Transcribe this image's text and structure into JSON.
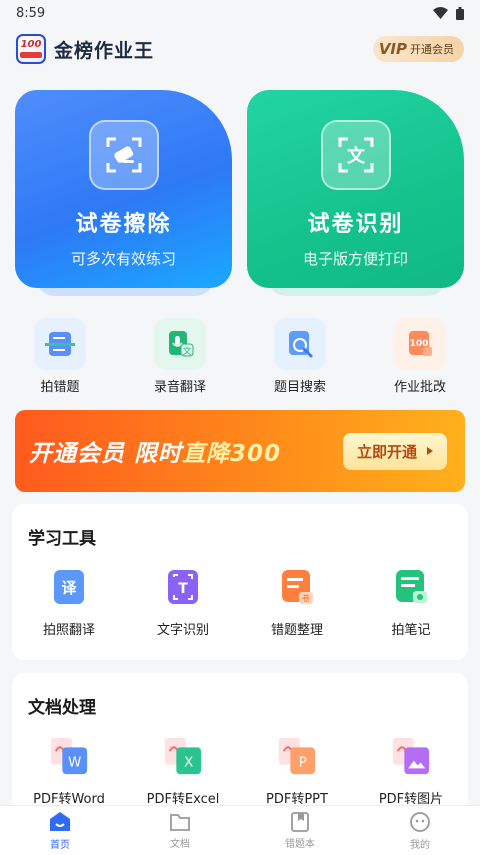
{
  "status": {
    "time": "8:59"
  },
  "header": {
    "app_title": "金榜作业王",
    "logo_text": "100",
    "vip_badge": "VIP",
    "vip_text": "开通会员"
  },
  "hero": [
    {
      "title": "试卷擦除",
      "subtitle": "可多次有效练习",
      "icon": "eraser-icon"
    },
    {
      "title": "试卷识别",
      "subtitle": "电子版方便打印",
      "icon": "scan-text-icon"
    }
  ],
  "quick": [
    {
      "label": "拍错题",
      "icon": "scan-document-icon"
    },
    {
      "label": "录音翻译",
      "icon": "voice-translate-icon"
    },
    {
      "label": "题目搜索",
      "icon": "search-question-icon"
    },
    {
      "label": "作业批改",
      "icon": "grade-homework-icon"
    }
  ],
  "banner": {
    "text_a": "开通会员 限时",
    "text_b": "直降300",
    "button": "立即开通"
  },
  "tools": {
    "title": "学习工具",
    "items": [
      {
        "label": "拍照翻译",
        "icon": "photo-translate-icon"
      },
      {
        "label": "文字识别",
        "icon": "text-recognition-icon"
      },
      {
        "label": "错题整理",
        "icon": "mistake-organize-icon"
      },
      {
        "label": "拍笔记",
        "icon": "photo-notes-icon"
      }
    ]
  },
  "docs": {
    "title": "文档处理",
    "items": [
      {
        "label": "PDF转Word",
        "icon": "pdf-to-word-icon",
        "badge": "W"
      },
      {
        "label": "PDF转Excel",
        "icon": "pdf-to-excel-icon",
        "badge": "X"
      },
      {
        "label": "PDF转PPT",
        "icon": "pdf-to-ppt-icon",
        "badge": "P"
      },
      {
        "label": "PDF转图片",
        "icon": "pdf-to-image-icon",
        "badge": ""
      }
    ]
  },
  "tabs": [
    {
      "label": "首页",
      "icon": "home-icon",
      "active": true
    },
    {
      "label": "文档",
      "icon": "folder-icon",
      "active": false
    },
    {
      "label": "错题本",
      "icon": "notebook-icon",
      "active": false
    },
    {
      "label": "我的",
      "icon": "profile-icon",
      "active": false
    }
  ],
  "colors": {
    "primary": "#2f6cf6",
    "green": "#14c28c",
    "orange": "#ff7a1a"
  }
}
